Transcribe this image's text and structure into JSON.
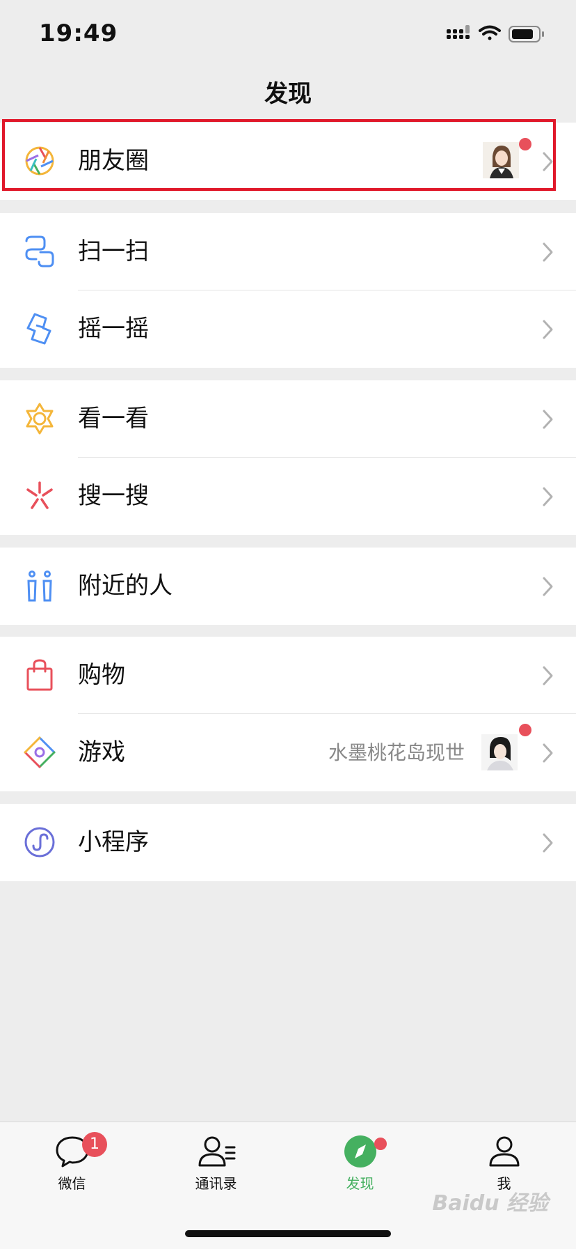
{
  "status_bar": {
    "time": "19:49"
  },
  "header": {
    "title": "发现"
  },
  "groups": [
    {
      "items": [
        {
          "label": "朋友圈",
          "icon": "moments-icon"
        }
      ]
    },
    {
      "items": [
        {
          "label": "扫一扫",
          "icon": "scan-icon"
        },
        {
          "label": "摇一摇",
          "icon": "shake-icon"
        }
      ]
    },
    {
      "items": [
        {
          "label": "看一看",
          "icon": "top-stories-icon"
        },
        {
          "label": "搜一搜",
          "icon": "search-icon"
        }
      ]
    },
    {
      "items": [
        {
          "label": "附近的人",
          "icon": "people-nearby-icon"
        }
      ]
    },
    {
      "items": [
        {
          "label": "购物",
          "icon": "shopping-bag-icon"
        },
        {
          "label": "游戏",
          "icon": "games-icon",
          "meta": "水墨桃花岛现世"
        }
      ]
    },
    {
      "items": [
        {
          "label": "小程序",
          "icon": "mini-programs-icon"
        }
      ]
    }
  ],
  "tab_bar": {
    "tabs": [
      {
        "label": "微信",
        "badge": "1",
        "icon": "chat-bubble-icon"
      },
      {
        "label": "通讯录",
        "icon": "contacts-icon"
      },
      {
        "label": "发现",
        "icon": "compass-icon",
        "active": true
      },
      {
        "label": "我",
        "icon": "person-icon"
      }
    ]
  },
  "watermark": "Baidu 经验",
  "colors": {
    "accent": "#45b060",
    "badge": "#e8505b",
    "highlight": "#e0182a"
  }
}
